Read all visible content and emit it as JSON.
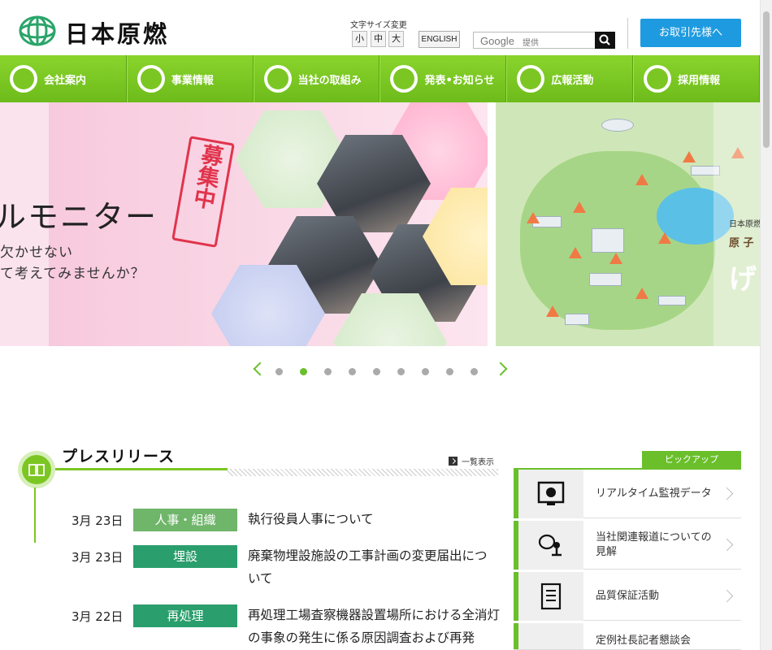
{
  "header": {
    "logo_text": "日本原燃",
    "fontsize_label": "文字サイズ変更",
    "fontsize_options": [
      "小",
      "中",
      "大"
    ],
    "english_label": "ENGLISH",
    "search_brand": "Google",
    "search_provided": "提供",
    "partners_label": "お取引先様へ"
  },
  "nav": {
    "items": [
      {
        "label": "会社案内",
        "icon": "people-icon"
      },
      {
        "label": "事業情報",
        "icon": "building-icon"
      },
      {
        "label": "当社の取組み",
        "icon": "sprout-icon"
      },
      {
        "label": "発表•お知らせ",
        "icon": "document-icon"
      },
      {
        "label": "広報活動",
        "icon": "speech-bubble-icon"
      },
      {
        "label": "採用情報",
        "icon": "handshake-icon"
      }
    ]
  },
  "hero": {
    "title": "ルモニター",
    "stamp": "募集中",
    "line1": "欠かせない",
    "line2": "て考えてみませんか？",
    "map_text1": "日本原燃",
    "map_text2": "原 子",
    "map_big": "げ"
  },
  "pager": {
    "total_dots": 9,
    "active_dot": 2
  },
  "press": {
    "title": "プレスリリース",
    "list_all": "一覧表示",
    "items": [
      {
        "date": "3月 23日",
        "category": "人事・組織",
        "color": "#6fb56a",
        "text": "執行役員人事について"
      },
      {
        "date": "3月 23日",
        "category": "埋設",
        "color": "#2a9e6c",
        "text": "廃棄物埋設施設の工事計画の変更届出について"
      },
      {
        "date": "3月 22日",
        "category": "再処理",
        "color": "#2a9e6c",
        "text": "再処理工場査察機器設置場所における全消灯の事象の発生に係る原因調査および再発"
      }
    ]
  },
  "pickup": {
    "tab_label": "ピックアップ",
    "items": [
      {
        "label": "リアルタイム監視データ",
        "icon": "monitor-icon"
      },
      {
        "label": "当社関連報道についての見解",
        "icon": "microphone-icon"
      },
      {
        "label": "品質保証活動",
        "icon": "checklist-icon"
      },
      {
        "label": "定例社長記者懇談会",
        "icon": "person-icon"
      }
    ]
  },
  "colors": {
    "brand_green": "#6abf2a",
    "partners_blue": "#1e9be0",
    "badge_hr": "#6fb56a",
    "badge_dark": "#2a9e6c"
  }
}
